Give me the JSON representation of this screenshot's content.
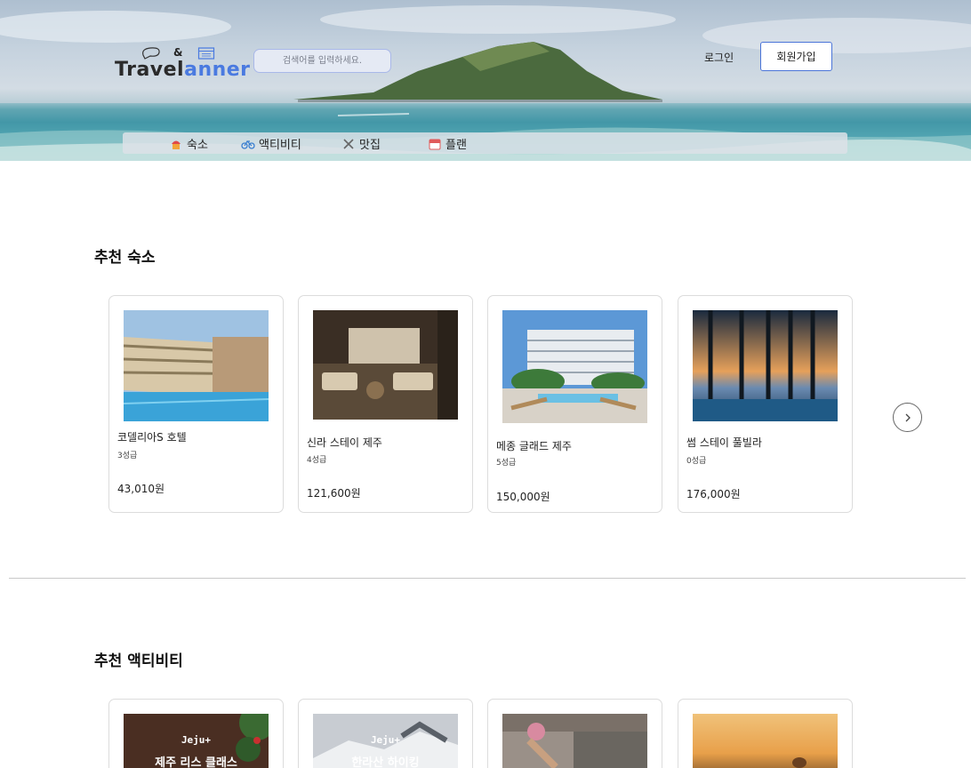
{
  "header": {
    "logo": {
      "amp": "&",
      "part1": "Travel",
      "part2": "anner"
    },
    "search_placeholder": "검색어를 입력하세요.",
    "login": "로그인",
    "signup": "회원가입"
  },
  "categories": [
    {
      "label": "숙소",
      "icon": "hotel-icon"
    },
    {
      "label": "액티비티",
      "icon": "bicycle-icon"
    },
    {
      "label": "맛집",
      "icon": "utensils-icon"
    },
    {
      "label": "플랜",
      "icon": "calendar-icon"
    }
  ],
  "sections": {
    "stays_title": "추천 숙소",
    "activities_title": "추천 액티비티"
  },
  "stays": [
    {
      "name": "코델리아S 호텔",
      "grade": "3성급",
      "price": "43,010원"
    },
    {
      "name": "신라 스테이 제주",
      "grade": "4성급",
      "price": "121,600원"
    },
    {
      "name": "메종 글래드 제주",
      "grade": "5성급",
      "price": "150,000원"
    },
    {
      "name": "썸 스테이 풀빌라",
      "grade": "0성급",
      "price": "176,000원"
    }
  ],
  "activities": [
    {
      "brand": "Jeju+",
      "title": "제주 리스 클래스"
    },
    {
      "brand": "Jeju+",
      "title": "한라산 하이킹"
    },
    {
      "brand": "",
      "title": ""
    },
    {
      "brand": "",
      "title": ""
    }
  ],
  "colors": {
    "accent": "#4a74d8",
    "logo_blue": "#4a7ae0"
  }
}
